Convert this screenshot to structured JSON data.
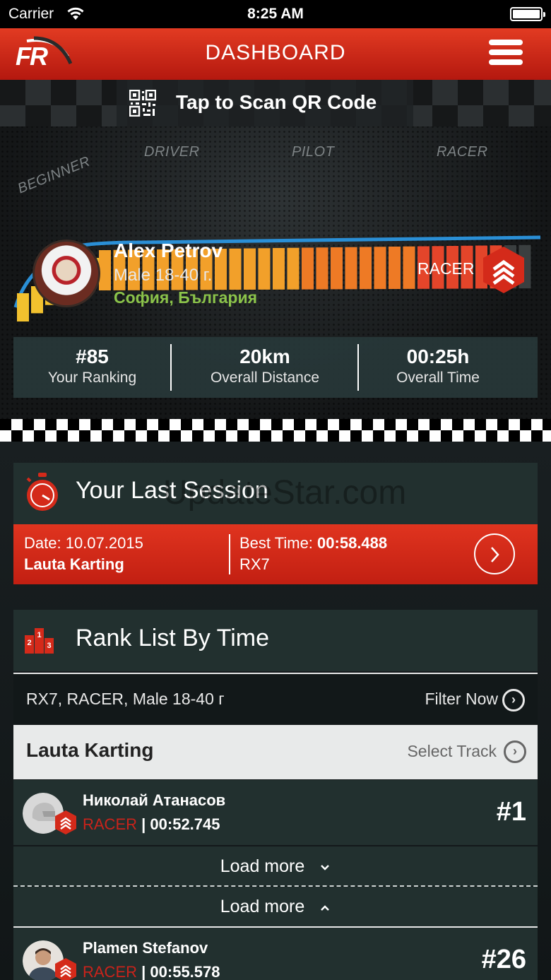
{
  "status_bar": {
    "carrier": "Carrier",
    "time": "8:25 AM"
  },
  "nav": {
    "logo": "FR",
    "title": "DASHBOARD"
  },
  "scan": {
    "label": "Tap to Scan QR Code"
  },
  "levels": [
    "BEGINNER",
    "DRIVER",
    "PILOT",
    "RACER"
  ],
  "profile": {
    "name": "Alex Petrov",
    "group": "Male 18-40 г.",
    "location": "София, България",
    "level": "RACER"
  },
  "stats": [
    {
      "value": "#85",
      "label": "Your Ranking"
    },
    {
      "value": "20km",
      "label": "Overall Distance"
    },
    {
      "value": "00:25h",
      "label": "Overall Time"
    }
  ],
  "last_session": {
    "title": "Your Last Session",
    "watermark": "UpdateStar.com",
    "date_prefix": "Date: ",
    "date": "10.07.2015",
    "track": "Lauta Karting",
    "best_prefix": "Best Time: ",
    "best_time": "00:58.488",
    "kart": "RX7"
  },
  "rank_list": {
    "title": "Rank List By Time",
    "filter_text": "RX7, RACER, Male 18-40 г",
    "filter_button": "Filter Now",
    "track": "Lauta Karting",
    "select_track": "Select Track",
    "load_more_down": "Load more",
    "load_more_up": "Load more",
    "entries": [
      {
        "name": "Николай Атанасов",
        "level": "RACER",
        "time": "00:52.745",
        "position": "#1"
      },
      {
        "name": "Plamen Stefanov",
        "level": "RACER",
        "time": "00:55.578",
        "position": "#26"
      }
    ]
  },
  "colors": {
    "accent": "#d42a1a",
    "location": "#8bc34a",
    "panel": "#22302f"
  }
}
